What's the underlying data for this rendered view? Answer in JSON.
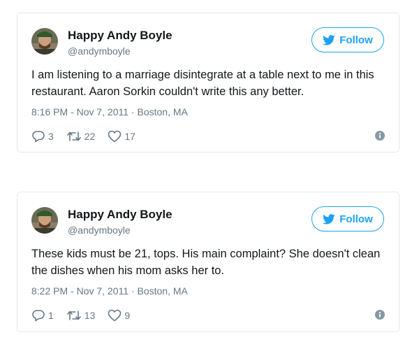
{
  "colors": {
    "accent": "#1da1f2",
    "text": "#14171a",
    "muted": "#657786",
    "border": "#e1e8ed"
  },
  "tweets": [
    {
      "author": "Happy Andy Boyle",
      "handle": "@andymboyle",
      "follow_label": "Follow",
      "text": "I am listening to a marriage disintegrate at a table next to me in this restaurant. Aaron Sorkin couldn't write this any better.",
      "meta": "8:16 PM - Nov 7, 2011 · Boston, MA",
      "replies": "3",
      "retweets": "22",
      "likes": "17",
      "icons": {
        "reply": "reply-icon",
        "retweet": "retweet-icon",
        "like": "heart-icon",
        "info": "info-icon",
        "follow": "twitter-bird-icon"
      }
    },
    {
      "author": "Happy Andy Boyle",
      "handle": "@andymboyle",
      "follow_label": "Follow",
      "text": "These kids must be 21, tops. His main complaint? She doesn't clean the dishes when his mom asks her to.",
      "meta": "8:22 PM - Nov 7, 2011 · Boston, MA",
      "replies": "1",
      "retweets": "13",
      "likes": "9",
      "icons": {
        "reply": "reply-icon",
        "retweet": "retweet-icon",
        "like": "heart-icon",
        "info": "info-icon",
        "follow": "twitter-bird-icon"
      }
    }
  ]
}
